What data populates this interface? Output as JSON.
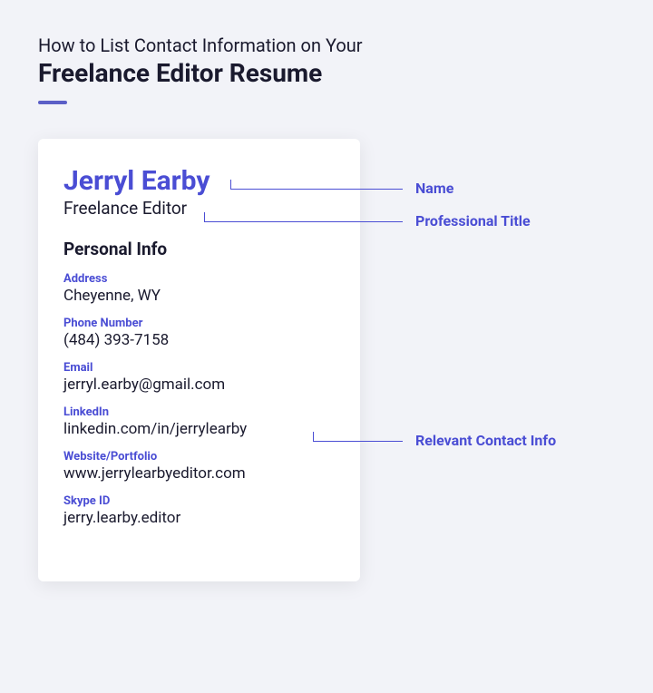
{
  "header": {
    "subtitle": "How to List Contact Information on Your",
    "title": "Freelance Editor Resume"
  },
  "resume": {
    "name": "Jerryl Earby",
    "professional_title": "Freelance Editor",
    "section_title": "Personal Info",
    "fields": {
      "address": {
        "label": "Address",
        "value": "Cheyenne, WY"
      },
      "phone": {
        "label": "Phone Number",
        "value": "(484) 393-7158"
      },
      "email": {
        "label": "Email",
        "value": "jerryl.earby@gmail.com"
      },
      "linkedin": {
        "label": "LinkedIn",
        "value": "linkedin.com/in/jerrylearby"
      },
      "portfolio": {
        "label": "Website/Portfolio",
        "value": "www.jerrylearbyeditor.com"
      },
      "skype": {
        "label": "Skype ID",
        "value": "jerry.learby.editor"
      }
    }
  },
  "annotations": {
    "name": "Name",
    "professional_title": "Professional Title",
    "contact_info": "Relevant Contact Info"
  }
}
